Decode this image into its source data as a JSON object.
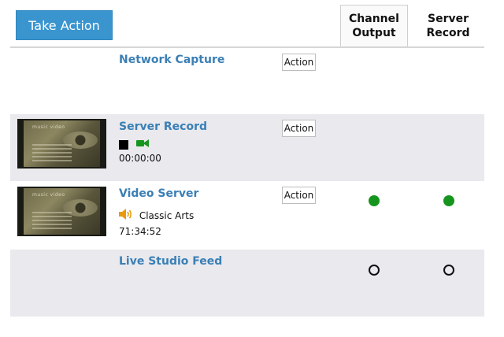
{
  "toolbar": {
    "take_action_label": "Take Action"
  },
  "columns": [
    {
      "line1": "Channel",
      "line2": "Output"
    },
    {
      "line1": "Server",
      "line2": "Record"
    }
  ],
  "rows": [
    {
      "name": "Network Capture",
      "action_label": "Action"
    },
    {
      "name": "Server Record",
      "action_label": "Action",
      "thumb_tag": "music video",
      "timecode": "00:00:00",
      "icons": [
        "stop-icon",
        "video-camera-icon"
      ]
    },
    {
      "name": "Video Server",
      "action_label": "Action",
      "thumb_tag": "music video",
      "audio_label": "Classic Arts",
      "timecode": "71:34:52",
      "channel_output": "on",
      "server_record": "on"
    },
    {
      "name": "Live Studio Feed",
      "channel_output": "off",
      "server_record": "off"
    }
  ],
  "colors": {
    "accent": "#3a95cf",
    "link": "#3a7fb5",
    "status_on": "#16951e",
    "alt_row": "#e9e9ee"
  }
}
